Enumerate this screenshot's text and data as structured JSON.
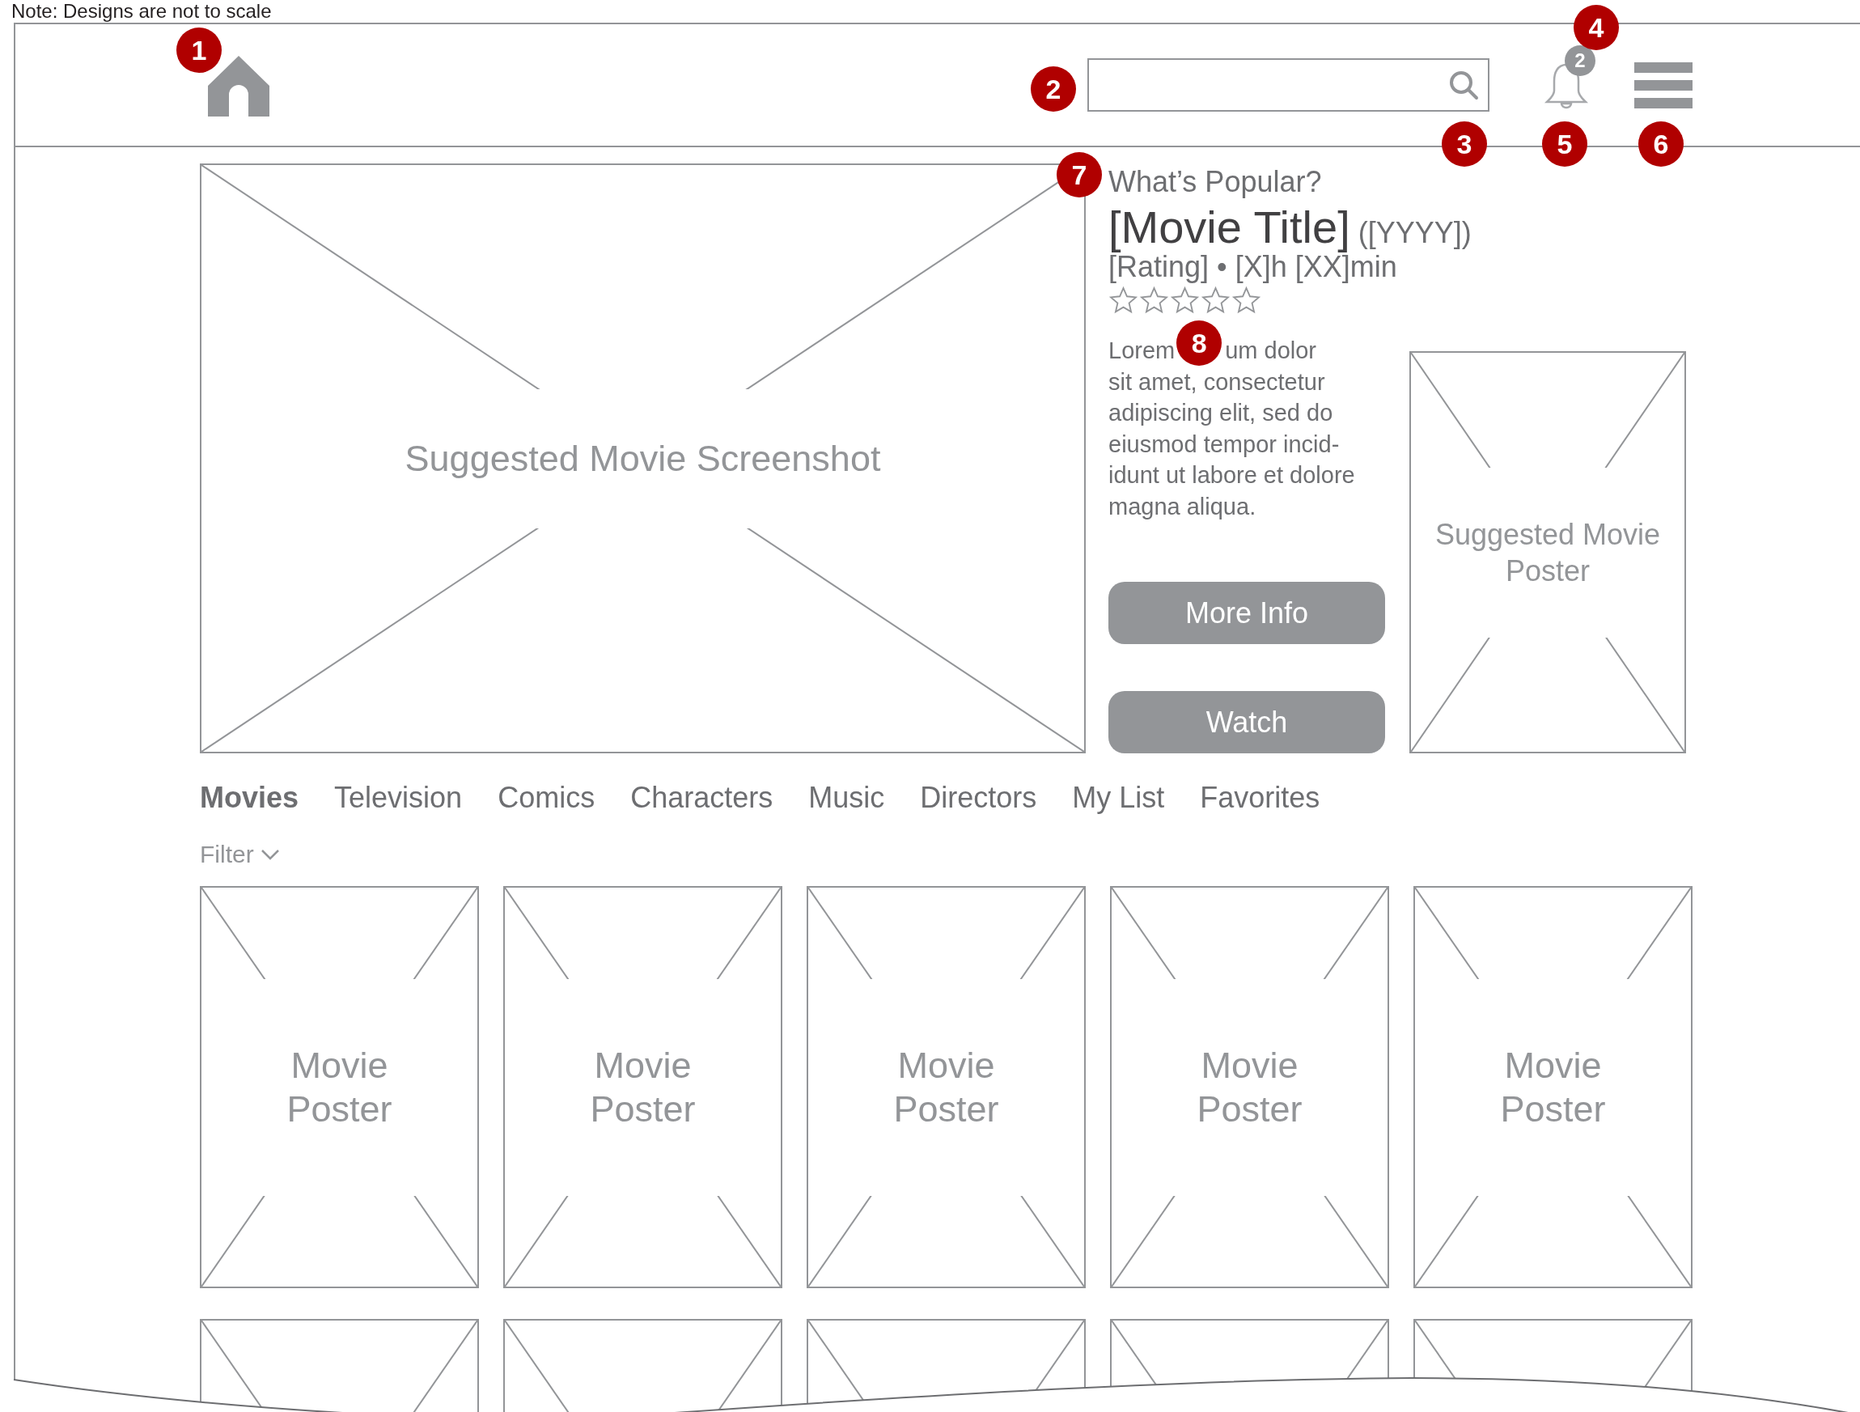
{
  "note": "Note: Designs are not to scale",
  "notifications": {
    "count": "2"
  },
  "hero": {
    "screenshot_label": "Suggested Movie Screenshot",
    "eyebrow": "What’s Popular?",
    "title": "[Movie Title]",
    "year": "([YYYY])",
    "meta": "[Rating] • [X]h [XX]min",
    "stars": 0,
    "description": {
      "before_callout": "Lorem",
      "after_callout": "um dolor",
      "rest": "sit amet, consectetur\nadipiscing elit, sed do\neiusmod tempor incid-\nidunt ut labore et dolore\nmagna aliqua."
    },
    "buttons": [
      "More Info",
      "Watch"
    ],
    "poster_label": "Suggested Movie Poster"
  },
  "tabs": [
    {
      "label": "Movies",
      "selected": true
    },
    {
      "label": "Television",
      "selected": false
    },
    {
      "label": "Comics",
      "selected": false
    },
    {
      "label": "Characters",
      "selected": false
    },
    {
      "label": "Music",
      "selected": false
    },
    {
      "label": "Directors",
      "selected": false
    },
    {
      "label": "My List",
      "selected": false
    },
    {
      "label": "Favorites",
      "selected": false
    }
  ],
  "filter": {
    "label": "Filter"
  },
  "posters": [
    {
      "kind": "placeholder",
      "label": "Movie Poster"
    },
    {
      "kind": "placeholder",
      "label": "Movie Poster"
    },
    {
      "kind": "placeholder",
      "label": "Movie Poster"
    },
    {
      "kind": "placeholder",
      "label": "Movie Poster"
    },
    {
      "kind": "placeholder",
      "label": "Movie Poster"
    },
    {
      "kind": "placeholder"
    },
    {
      "kind": "placeholder"
    },
    {
      "kind": "placeholder"
    },
    {
      "kind": "placeholder"
    },
    {
      "kind": "placeholder"
    }
  ],
  "annotations": [
    "1",
    "2",
    "3",
    "4",
    "5",
    "6",
    "7",
    "8"
  ]
}
